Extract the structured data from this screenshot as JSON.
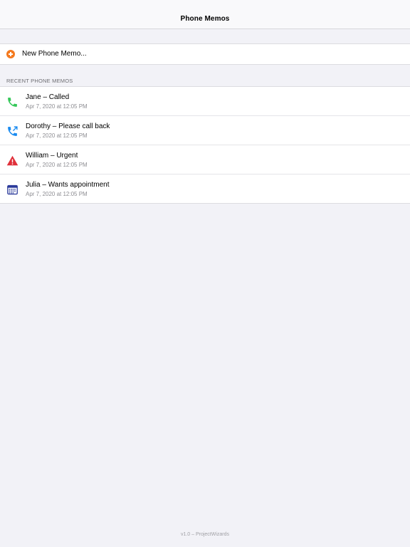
{
  "nav": {
    "title": "Phone Memos"
  },
  "new_memo": {
    "label": "New Phone Memo...",
    "icon": "plus-circle-icon",
    "icon_color": "#f47a1f"
  },
  "recent": {
    "header": "RECENT PHONE MEMOS",
    "items": [
      {
        "title": "Jane – Called",
        "date": "Apr 7, 2020 at 12:05 PM",
        "icon": "phone-icon",
        "icon_color": "#34c759"
      },
      {
        "title": "Dorothy – Please call back",
        "date": "Apr 7, 2020 at 12:05 PM",
        "icon": "phone-callback-icon",
        "icon_color": "#1a8bf0"
      },
      {
        "title": "William – Urgent",
        "date": "Apr 7, 2020 at 12:05 PM",
        "icon": "warning-icon",
        "icon_color": "#e0303a"
      },
      {
        "title": "Julia – Wants appointment",
        "date": "Apr 7, 2020 at 12:05 PM",
        "icon": "calendar-icon",
        "icon_color": "#2b3a9a"
      }
    ]
  },
  "footer": {
    "text": "v1.0 – ProjectWizards"
  }
}
